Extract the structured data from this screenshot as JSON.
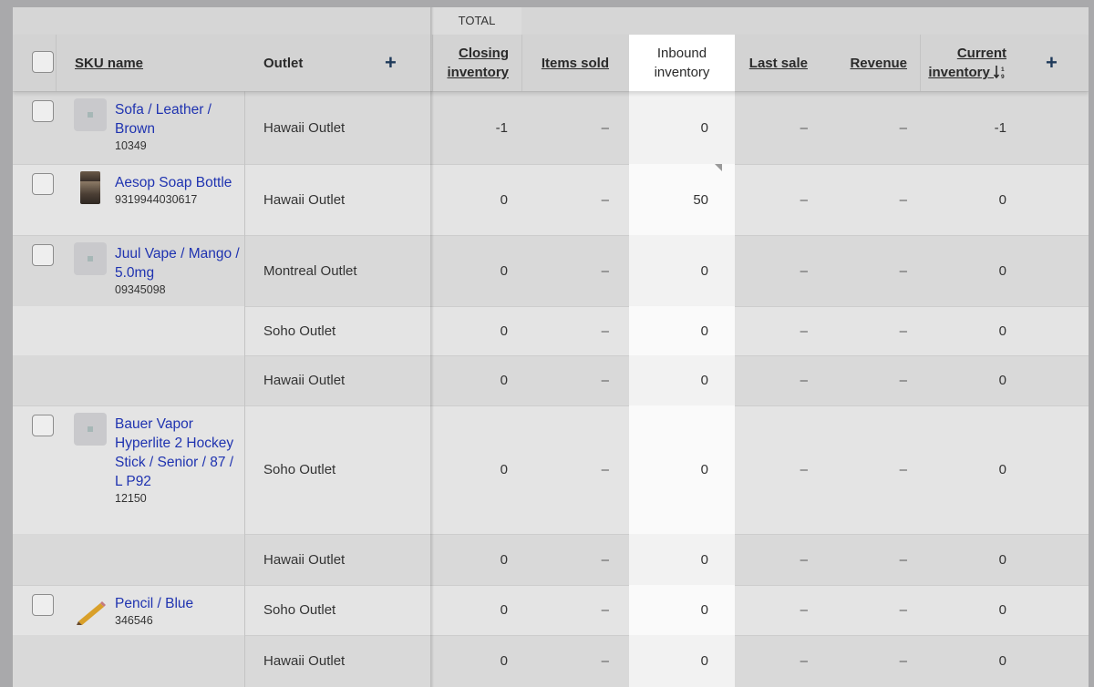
{
  "total_label": "TOTAL",
  "header": {
    "sku_name": "SKU name",
    "outlet": "Outlet",
    "closing_inventory": "Closing inventory",
    "items_sold": "Items sold",
    "inbound_inventory": "Inbound inventory",
    "last_sale": "Last sale",
    "revenue": "Revenue",
    "current_inventory": "Current inventory",
    "sort_icon": "sort-ascending-numeric-icon",
    "add_column_icon": "plus-icon"
  },
  "rows": [
    {
      "sku_name": "Sofa / Leather / Brown",
      "sku_code": "10349",
      "thumb": "placeholder",
      "outlet": "Hawaii Outlet",
      "closing": "-1",
      "items_sold": "–",
      "inbound": "0",
      "last_sale": "–",
      "revenue": "–",
      "current": "-1"
    },
    {
      "sku_name": "Aesop Soap Bottle",
      "sku_code": "9319944030617",
      "thumb": "soap-bottle",
      "outlet": "Hawaii Outlet",
      "closing": "0",
      "items_sold": "–",
      "inbound": "50",
      "last_sale": "–",
      "revenue": "–",
      "current": "0"
    },
    {
      "sku_name": "Juul Vape / Mango / 5.0mg",
      "sku_code": "09345098",
      "thumb": "placeholder",
      "outlet": "Montreal Outlet",
      "closing": "0",
      "items_sold": "–",
      "inbound": "0",
      "last_sale": "–",
      "revenue": "–",
      "current": "0"
    },
    {
      "sku_name": "",
      "sku_code": "",
      "outlet": "Soho Outlet",
      "closing": "0",
      "items_sold": "–",
      "inbound": "0",
      "last_sale": "–",
      "revenue": "–",
      "current": "0"
    },
    {
      "sku_name": "",
      "sku_code": "",
      "outlet": "Hawaii Outlet",
      "closing": "0",
      "items_sold": "–",
      "inbound": "0",
      "last_sale": "–",
      "revenue": "–",
      "current": "0"
    },
    {
      "sku_name": "Bauer Vapor Hyperlite 2 Hockey Stick / Senior / 87 / L P92",
      "sku_code": "12150",
      "thumb": "placeholder",
      "outlet": "Soho Outlet",
      "closing": "0",
      "items_sold": "–",
      "inbound": "0",
      "last_sale": "–",
      "revenue": "–",
      "current": "0"
    },
    {
      "sku_name": "",
      "sku_code": "",
      "outlet": "Hawaii Outlet",
      "closing": "0",
      "items_sold": "–",
      "inbound": "0",
      "last_sale": "–",
      "revenue": "–",
      "current": "0"
    },
    {
      "sku_name": "Pencil / Blue",
      "sku_code": "346546",
      "thumb": "pencil",
      "outlet": "Soho Outlet",
      "closing": "0",
      "items_sold": "–",
      "inbound": "0",
      "last_sale": "–",
      "revenue": "–",
      "current": "0"
    },
    {
      "sku_name": "",
      "sku_code": "",
      "outlet": "Hawaii Outlet",
      "closing": "0",
      "items_sold": "–",
      "inbound": "0",
      "last_sale": "–",
      "revenue": "–",
      "current": "0"
    }
  ]
}
